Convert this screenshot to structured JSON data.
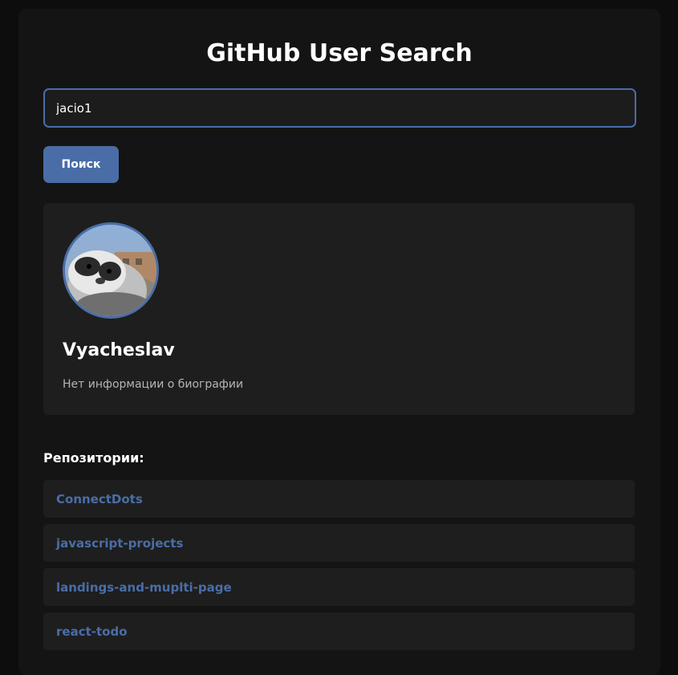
{
  "header": {
    "title": "GitHub User Search"
  },
  "search": {
    "value": "jacio1",
    "button_label": "Поиск"
  },
  "profile": {
    "name": "Vyacheslav",
    "bio": "Нет информации о биографии",
    "avatar_icon": "penguin-chick-avatar"
  },
  "repositories": {
    "heading": "Репозитории:",
    "items": [
      {
        "name": "ConnectDots"
      },
      {
        "name": "javascript-projects"
      },
      {
        "name": "landings-and-muplti-page"
      },
      {
        "name": "react-todo"
      }
    ]
  },
  "colors": {
    "accent": "#4a6da7",
    "background": "#0d0d0d",
    "panel": "#141414",
    "card": "#1e1e1e",
    "muted_text": "#b5b5b5"
  }
}
